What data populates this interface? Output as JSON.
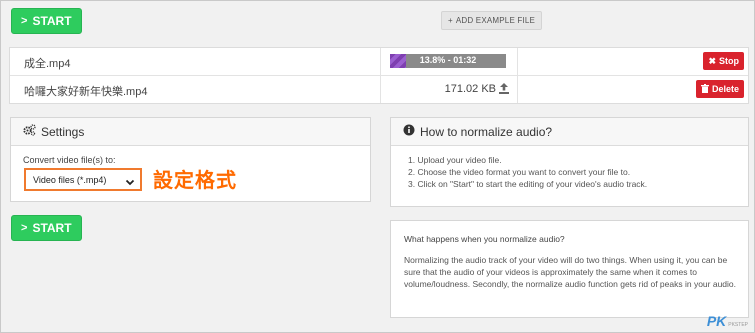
{
  "toolbar": {
    "start_label": "START",
    "add_example_label": "ADD EXAMPLE FILE"
  },
  "files": [
    {
      "name": "成全.mp4",
      "progress_label": "13.8% - 01:32",
      "progress_fraction": 0.138,
      "action_label": "Stop"
    },
    {
      "name": "哈囉大家好新年快樂.mp4",
      "size": "171.02 KB",
      "action_label": "Delete"
    }
  ],
  "settings": {
    "title": "Settings",
    "convert_label": "Convert video file(s) to:",
    "format_value": "Video files (*.mp4)",
    "annotation": "設定格式"
  },
  "howto": {
    "title": "How to normalize audio?",
    "steps": [
      "1. Upload your video file.",
      "2. Choose the video format you want to convert your file to.",
      "3. Click on \"Start\" to start the editing of your video's audio track."
    ]
  },
  "what_happens": {
    "title": "What happens when you normalize audio?",
    "body": "Normalizing the audio track of your video will do two things. When using it, you can be sure that the audio of your videos is approximately the same when it comes to volume/loudness. Secondly, the normalize audio function gets rid of peaks in your audio."
  },
  "watermark": {
    "logo": "PK",
    "sub": "PKSTEP"
  },
  "colors": {
    "start_green": "#2ecc5e",
    "danger_red": "#d9232d",
    "highlight_orange": "#f07a2e",
    "progress_purple": "#7e3fb0"
  }
}
